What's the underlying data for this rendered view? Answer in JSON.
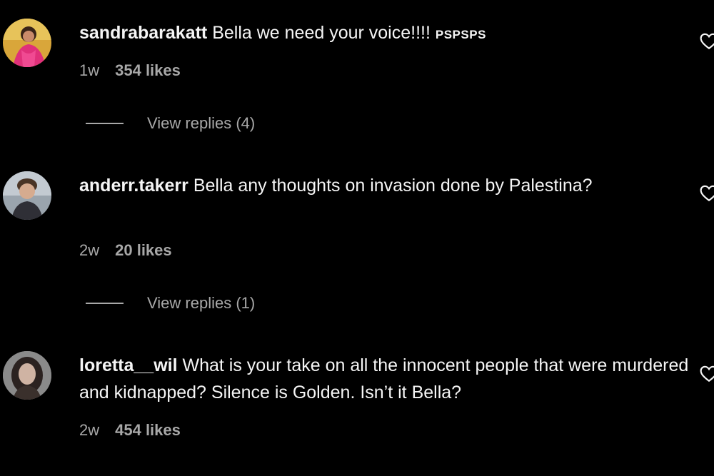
{
  "colors": {
    "background": "#000000",
    "primary_text": "#f5f5f5",
    "secondary_text": "#a8a8a8"
  },
  "comments": [
    {
      "username": "sandrabarakatt",
      "text": " Bella we need your voice!!!! ",
      "suffix": "PSPSPS",
      "age": "1w",
      "likes": "354 likes",
      "replies_label": "View replies (4)",
      "avatar_icon": "avatar-photo"
    },
    {
      "username": "anderr.takerr",
      "text": " Bella any thoughts on invasion done by Palestina?",
      "age": "2w",
      "likes": "20 likes",
      "replies_label": "View replies (1)",
      "avatar_icon": "avatar-photo"
    },
    {
      "username": "loretta__wil",
      "text": " What is your take on all the innocent people that were murdered and kidnapped? Silence is Golden. Isn’t it Bella?",
      "age": "2w",
      "likes": "454 likes",
      "avatar_icon": "avatar-photo"
    }
  ]
}
